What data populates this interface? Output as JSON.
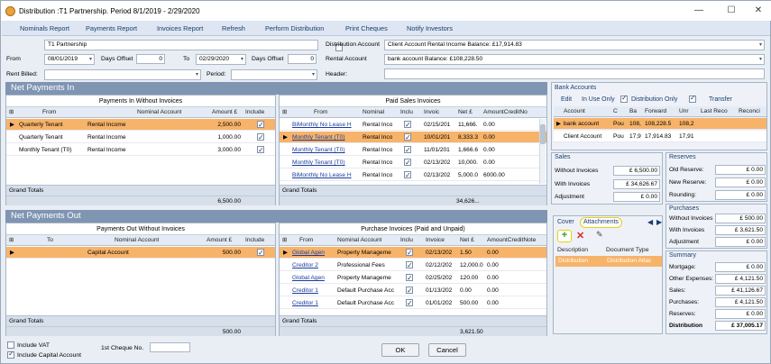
{
  "title": "Distribution :T1 Partnership. Period 8/1/2019 - 2/29/2020",
  "toolbar": {
    "nominals_report": "Nominals Report",
    "payments_report": "Payments Report",
    "invoices_report": "Invoices Report",
    "refresh": "Refresh",
    "perform_distribution": "Perform Distribution",
    "print_cheques": "Print Cheques",
    "notify_investors": "Notify Investors"
  },
  "header": {
    "partnership": "T1 Partnership",
    "from_label": "From",
    "from_value": "08/01/2019",
    "days_offset_label": "Days Offset",
    "days_offset_value": "0",
    "to_label": "To",
    "to_value": "02/29/2020",
    "days_offset2_label": "Days Offset",
    "days_offset2_value": "0",
    "rent_billed_label": "Rent Billed:",
    "period_label": "Period:",
    "distribution_account_label": "Distribution Account",
    "distribution_account_value": "Client Account  Rental Income   Balance: £17,914.83",
    "rental_account_label": "Rental Account",
    "rental_account_value": "bank account   Balance: £108,228.50",
    "header_label": "Header:"
  },
  "net_payments_in": {
    "section_title": "Net Payments In",
    "without_invoices": {
      "title": "Payments In Without Invoices",
      "columns": [
        "From",
        "Nominal Account",
        "Amount £",
        "Include"
      ],
      "rows": [
        {
          "from": "Quarterly Tenant",
          "nominal": "Rental Income",
          "amount": "2,500.00",
          "include": true
        },
        {
          "from": "Quarterly Tenant",
          "nominal": "Rental Income",
          "amount": "1,000.00",
          "include": true
        },
        {
          "from": "Monthly Tenant (T0)",
          "nominal": "Rental Income",
          "amount": "3,000.00",
          "include": true
        }
      ],
      "grand_totals_label": "Grand Totals",
      "total": "6,500.00"
    },
    "paid_sales_invoices": {
      "title": "Paid Sales Invoices",
      "columns": [
        "From",
        "Nominal",
        "Inclu",
        "Invoic",
        "Net £",
        "AmountCreditNo"
      ],
      "rows": [
        {
          "from": "BiMonthly No Lease H",
          "nominal": "Rental Inco",
          "include": true,
          "invoice": "02/15/201",
          "net": "11,666.",
          "credit": "0.00"
        },
        {
          "from": "Monthly Tenant (T0)",
          "nominal": "Rental Inco",
          "include": true,
          "invoice": "10/01/201",
          "net": "8,333.3",
          "credit": "0.00"
        },
        {
          "from": "Monthly Tenant (T0)",
          "nominal": "Rental Inco",
          "include": true,
          "invoice": "11/01/201",
          "net": "1,666.6",
          "credit": "0.00"
        },
        {
          "from": "Monthly Tenant (T0)",
          "nominal": "Rental Inco",
          "include": true,
          "invoice": "02/13/202",
          "net": "10,000.",
          "credit": "0.00"
        },
        {
          "from": "BiMonthly No Lease H",
          "nominal": "Rental Inco",
          "include": true,
          "invoice": "02/13/202",
          "net": "5,000.0",
          "credit": "6000.00"
        }
      ],
      "grand_totals_label": "Grand Totals",
      "total": "34,626..."
    }
  },
  "net_payments_out": {
    "section_title": "Net Payments Out",
    "without_invoices": {
      "title": "Payments Out Without Invoices",
      "columns": [
        "To",
        "Nominal Account",
        "Amount £",
        "Include"
      ],
      "rows": [
        {
          "to": "",
          "nominal": "Capital Account",
          "amount": "500.00",
          "include": true
        }
      ],
      "grand_totals_label": "Grand Totals",
      "total": "500.00"
    },
    "purchase_invoices": {
      "title": "Purchase Invoices (Paid and Unpaid)",
      "columns": [
        "From",
        "Nominal Account",
        "Inclu",
        "Invoice",
        "Net £",
        "AmountCreditNote"
      ],
      "rows": [
        {
          "from": "Global Agen",
          "nominal": "Property Manageme",
          "include": true,
          "invoice": "02/13/202",
          "net": "1.50",
          "credit": "0.00"
        },
        {
          "from": "Creditor 2",
          "nominal": "Professional Fees",
          "include": true,
          "invoice": "02/12/202",
          "net": "12,000.0",
          "credit": "0.00"
        },
        {
          "from": "Global Agen",
          "nominal": "Property Manageme",
          "include": true,
          "invoice": "02/25/202",
          "net": "120.00",
          "credit": "0.00"
        },
        {
          "from": "Creditor 1",
          "nominal": "Default Purchase Acc",
          "include": true,
          "invoice": "01/13/202",
          "net": "0.00",
          "credit": "0.00"
        },
        {
          "from": "Creditor 1",
          "nominal": "Default Purchase Acc",
          "include": true,
          "invoice": "01/01/202",
          "net": "500.00",
          "credit": "0.00"
        }
      ],
      "grand_totals_label": "Grand Totals",
      "total": "3,621.50"
    }
  },
  "bank_accounts": {
    "title": "Bank Accounts",
    "edit": "Edit",
    "in_use_only": "In Use Only",
    "distribution_only": "Distribution Only",
    "transfer": "Transfer",
    "columns": [
      "Account",
      "C",
      "Ba",
      "Forward",
      "Unr",
      "Last Reco",
      "Reconci"
    ],
    "rows": [
      {
        "account": "bank account",
        "c": "Pou",
        "ba": "108,",
        "forward": "108,228.5",
        "unr": "108,2",
        "last": "",
        "rec": ""
      },
      {
        "account": "Client Account",
        "c": "Pou",
        "ba": "17,9",
        "forward": "17,914.83",
        "unr": "17,91",
        "last": "",
        "rec": ""
      }
    ]
  },
  "sales": {
    "title": "Sales",
    "without_invoices_label": "Without Invoices",
    "without_invoices_value": "£ 6,500.00",
    "with_invoices_label": "With Invoices",
    "with_invoices_value": "£ 34,626.67",
    "adjustment_label": "Adjustment",
    "adjustment_value": "£ 0.00"
  },
  "reserves": {
    "title": "Reserves",
    "old_label": "Old Reserve:",
    "old_value": "£ 0.00",
    "new_label": "New Reserve:",
    "new_value": "£ 0.00",
    "rounding_label": "Rounding:",
    "rounding_value": "£ 0.00"
  },
  "purchases": {
    "title": "Purchases",
    "without_invoices_label": "Without Invoices",
    "without_invoices_value": "£ 500.00",
    "with_invoices_label": "With Invoices",
    "with_invoices_value": "£ 3,621.50",
    "adjustment_label": "Adjustment",
    "adjustment_value": "£ 0.00"
  },
  "attachments": {
    "tab_cover": "Cover",
    "tab_attachments": "Attachments",
    "col_description": "Description",
    "col_document_type": "Document Type",
    "row_description": "Distribution",
    "row_document_type": "Distribution Attac"
  },
  "summary": {
    "title": "Summary",
    "mortgage_label": "Mortgage:",
    "mortgage_value": "£ 0.00",
    "other_expenses_label": "Other Expenses:",
    "other_expenses_value": "£ 4,121.50",
    "sales_label": "Sales:",
    "sales_value": "£ 41,126.67",
    "purchases_label": "Purchases:",
    "purchases_value": "£ 4,121.50",
    "reserves_label": "Reserves:",
    "reserves_value": "£ 0.00",
    "distribution_label": "Distribution",
    "distribution_value": "£ 37,005.17"
  },
  "footer": {
    "include_vat": "Include VAT",
    "include_capital_account": "Include Capital Account",
    "first_cheque_label": "1st Cheque No.",
    "ok": "OK",
    "cancel": "Cancel"
  },
  "colors": {
    "selected_row": "#f7b36a",
    "section_header": "#7f95b2",
    "accent": "#1b3d6d"
  }
}
